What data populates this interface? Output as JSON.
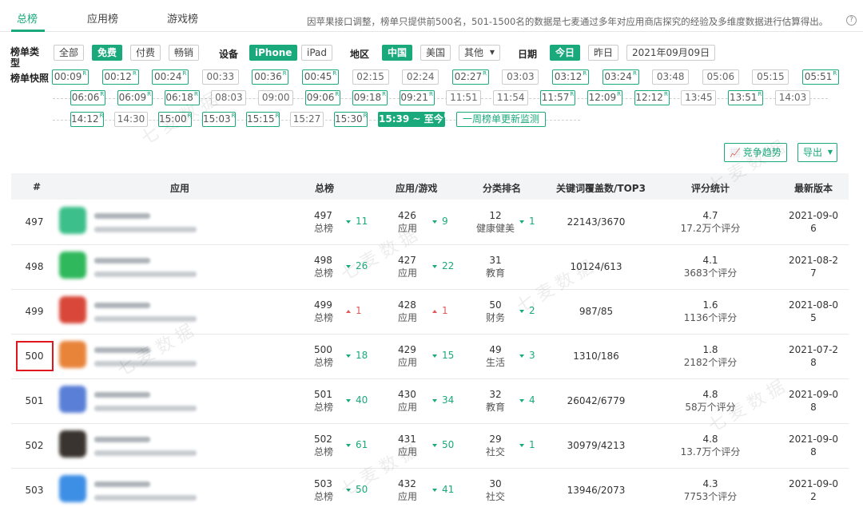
{
  "tabs": [
    {
      "label": "总榜",
      "active": true
    },
    {
      "label": "应用榜",
      "active": false
    },
    {
      "label": "游戏榜",
      "active": false
    }
  ],
  "notice": "因苹果接口调整，榜单只提供前500名，501-1500名的数据是七麦通过多年对应用商店探究的经验及多维度数据进行估算得出。",
  "filters": {
    "type_label": "榜单类型",
    "types": [
      {
        "label": "全部",
        "active": false
      },
      {
        "label": "免费",
        "active": true
      },
      {
        "label": "付费",
        "active": false
      },
      {
        "label": "畅销",
        "active": false
      }
    ],
    "device_label": "设备",
    "devices": [
      {
        "label": "iPhone",
        "active": true
      },
      {
        "label": "iPad",
        "active": false
      }
    ],
    "region_label": "地区",
    "regions": [
      {
        "label": "中国",
        "active": true
      },
      {
        "label": "美国",
        "active": false
      },
      {
        "label": "其他",
        "active": false
      }
    ],
    "date_label": "日期",
    "dates": [
      {
        "label": "今日",
        "active": true
      },
      {
        "label": "昨日",
        "active": false
      },
      {
        "label": "2021年09月09日",
        "active": false
      }
    ]
  },
  "snapshots": {
    "label": "榜单快照",
    "items": [
      {
        "t": "00:09",
        "m": true
      },
      {
        "t": "00:12",
        "m": true
      },
      {
        "t": "00:24",
        "m": true
      },
      {
        "t": "00:33",
        "m": false
      },
      {
        "t": "00:36",
        "m": true
      },
      {
        "t": "00:45",
        "m": true
      },
      {
        "t": "02:15",
        "m": false
      },
      {
        "t": "02:24",
        "m": false
      },
      {
        "t": "02:27",
        "m": true
      },
      {
        "t": "03:03",
        "m": false
      },
      {
        "t": "03:12",
        "m": true
      },
      {
        "t": "03:24",
        "m": true
      },
      {
        "t": "03:48",
        "m": false
      },
      {
        "t": "05:06",
        "m": false
      },
      {
        "t": "05:15",
        "m": false
      },
      {
        "t": "05:51",
        "m": true
      },
      {
        "t": "06:06",
        "m": true
      },
      {
        "t": "06:09",
        "m": true
      },
      {
        "t": "06:18",
        "m": true
      },
      {
        "t": "08:03",
        "m": false
      },
      {
        "t": "09:00",
        "m": false
      },
      {
        "t": "09:06",
        "m": true
      },
      {
        "t": "09:18",
        "m": true
      },
      {
        "t": "09:21",
        "m": true
      },
      {
        "t": "11:51",
        "m": false
      },
      {
        "t": "11:54",
        "m": false
      },
      {
        "t": "11:57",
        "m": true
      },
      {
        "t": "12:09",
        "m": true
      },
      {
        "t": "12:12",
        "m": true
      },
      {
        "t": "13:45",
        "m": false
      },
      {
        "t": "13:51",
        "m": true
      },
      {
        "t": "14:03",
        "m": false
      },
      {
        "t": "14:12",
        "m": true
      },
      {
        "t": "14:30",
        "m": false
      },
      {
        "t": "15:00",
        "m": true
      },
      {
        "t": "15:03",
        "m": true
      },
      {
        "t": "15:15",
        "m": true
      },
      {
        "t": "15:27",
        "m": false
      },
      {
        "t": "15:30",
        "m": true
      },
      {
        "t": "15:39 ~ 至今",
        "m": true,
        "on": true
      }
    ],
    "marker": "R",
    "weekly": "一周榜单更新监测"
  },
  "actions": {
    "trend": "竞争趋势",
    "export": "导出"
  },
  "table": {
    "headers": [
      "#",
      "应用",
      "总榜",
      "应用/游戏",
      "分类排名",
      "关键词覆盖数/TOP3",
      "评分统计",
      "最新版本"
    ],
    "rows": [
      {
        "rank": "497",
        "c": "#3cbf8a",
        "total": "497",
        "total_sub": "总榜",
        "total_delta": "11",
        "total_dir": "dn",
        "ag": "426",
        "ag_sub": "应用",
        "ag_delta": "9",
        "ag_dir": "dn",
        "cat": "12",
        "cat_sub": "健康健美",
        "cat_delta": "1",
        "cat_dir": "dn",
        "kw": "22143/3670",
        "score": "4.7",
        "score_sub": "17.2万个评分",
        "ver1": "2021-09-0",
        "ver2": "6"
      },
      {
        "rank": "498",
        "c": "#2fb85c",
        "total": "498",
        "total_sub": "总榜",
        "total_delta": "26",
        "total_dir": "dn",
        "ag": "427",
        "ag_sub": "应用",
        "ag_delta": "22",
        "ag_dir": "dn",
        "cat": "31",
        "cat_sub": "教育",
        "cat_delta": "",
        "cat_dir": "",
        "kw": "10124/613",
        "score": "4.1",
        "score_sub": "3683个评分",
        "ver1": "2021-08-2",
        "ver2": "7"
      },
      {
        "rank": "499",
        "c": "#d8473a",
        "total": "499",
        "total_sub": "总榜",
        "total_delta": "1",
        "total_dir": "up",
        "ag": "428",
        "ag_sub": "应用",
        "ag_delta": "1",
        "ag_dir": "up",
        "cat": "50",
        "cat_sub": "财务",
        "cat_delta": "2",
        "cat_dir": "dn",
        "kw": "987/85",
        "score": "1.6",
        "score_sub": "1136个评分",
        "ver1": "2021-08-0",
        "ver2": "5"
      },
      {
        "rank": "500",
        "c": "#e8843a",
        "total": "500",
        "total_sub": "总榜",
        "total_delta": "18",
        "total_dir": "dn",
        "ag": "429",
        "ag_sub": "应用",
        "ag_delta": "15",
        "ag_dir": "dn",
        "cat": "49",
        "cat_sub": "生活",
        "cat_delta": "3",
        "cat_dir": "dn",
        "kw": "1310/186",
        "score": "1.8",
        "score_sub": "2182个评分",
        "ver1": "2021-07-2",
        "ver2": "8",
        "highlight": true
      },
      {
        "rank": "501",
        "c": "#5a7fd6",
        "total": "501",
        "total_sub": "总榜",
        "total_delta": "40",
        "total_dir": "dn",
        "ag": "430",
        "ag_sub": "应用",
        "ag_delta": "34",
        "ag_dir": "dn",
        "cat": "32",
        "cat_sub": "教育",
        "cat_delta": "4",
        "cat_dir": "dn",
        "kw": "26042/6779",
        "score": "4.8",
        "score_sub": "58万个评分",
        "ver1": "2021-09-0",
        "ver2": "8"
      },
      {
        "rank": "502",
        "c": "#3a3430",
        "total": "502",
        "total_sub": "总榜",
        "total_delta": "61",
        "total_dir": "dn",
        "ag": "431",
        "ag_sub": "应用",
        "ag_delta": "50",
        "ag_dir": "dn",
        "cat": "29",
        "cat_sub": "社交",
        "cat_delta": "1",
        "cat_dir": "dn",
        "kw": "30979/4213",
        "score": "4.8",
        "score_sub": "13.7万个评分",
        "ver1": "2021-09-0",
        "ver2": "8"
      },
      {
        "rank": "503",
        "c": "#3d8fe6",
        "total": "503",
        "total_sub": "总榜",
        "total_delta": "50",
        "total_dir": "dn",
        "ag": "432",
        "ag_sub": "应用",
        "ag_delta": "41",
        "ag_dir": "dn",
        "cat": "30",
        "cat_sub": "社交",
        "cat_delta": "",
        "cat_dir": "",
        "kw": "13946/2073",
        "score": "4.3",
        "score_sub": "7753个评分",
        "ver1": "2021-09-0",
        "ver2": "2"
      }
    ]
  }
}
